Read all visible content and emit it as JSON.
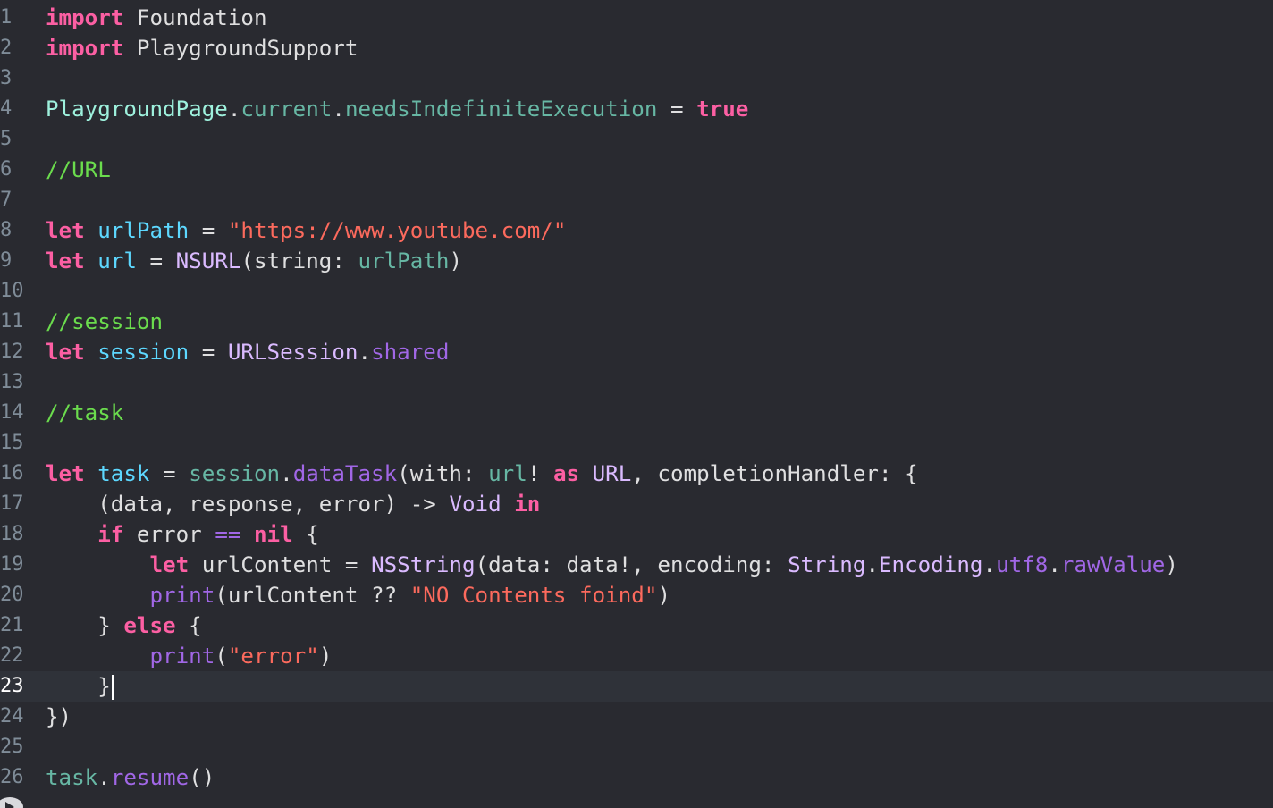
{
  "editor": {
    "language": "swift",
    "active_line": 23,
    "colors": {
      "background": "#292a30",
      "keyword": "#fc5fa3",
      "plain": "#dfdfe0",
      "type": "#dabaff",
      "project_symbol": "#67b7a4",
      "declaration": "#5dd8ff",
      "string": "#fc6a5d",
      "comment": "#6bdc4d",
      "method": "#a167e6"
    },
    "icons": {
      "run": "play-icon"
    },
    "line_numbers": [
      "1",
      "2",
      "3",
      "4",
      "5",
      "6",
      "7",
      "8",
      "9",
      "10",
      "11",
      "12",
      "13",
      "14",
      "15",
      "16",
      "17",
      "18",
      "19",
      "20",
      "21",
      "22",
      "23",
      "24",
      "25",
      "26"
    ],
    "lines": [
      [
        {
          "t": "kw",
          "v": "import"
        },
        {
          "t": "plain",
          "v": " Foundation"
        }
      ],
      [
        {
          "t": "kw",
          "v": "import"
        },
        {
          "t": "plain",
          "v": " PlaygroundSupport"
        }
      ],
      [],
      [
        {
          "t": "proj",
          "v": "PlaygroundPage"
        },
        {
          "t": "plain",
          "v": "."
        },
        {
          "t": "obj",
          "v": "current"
        },
        {
          "t": "plain",
          "v": "."
        },
        {
          "t": "obj",
          "v": "needsIndefiniteExecution"
        },
        {
          "t": "plain",
          "v": " = "
        },
        {
          "t": "kw",
          "v": "true"
        }
      ],
      [],
      [
        {
          "t": "com",
          "v": "//URL"
        }
      ],
      [],
      [
        {
          "t": "kw",
          "v": "let"
        },
        {
          "t": "plain",
          "v": " "
        },
        {
          "t": "var",
          "v": "urlPath"
        },
        {
          "t": "plain",
          "v": " = "
        },
        {
          "t": "str",
          "v": "\"https://www.youtube.com/\""
        }
      ],
      [
        {
          "t": "kw",
          "v": "let"
        },
        {
          "t": "plain",
          "v": " "
        },
        {
          "t": "var",
          "v": "url"
        },
        {
          "t": "plain",
          "v": " = "
        },
        {
          "t": "type",
          "v": "NSURL"
        },
        {
          "t": "plain",
          "v": "(string: "
        },
        {
          "t": "obj",
          "v": "urlPath"
        },
        {
          "t": "plain",
          "v": ")"
        }
      ],
      [],
      [
        {
          "t": "com",
          "v": "//session"
        }
      ],
      [
        {
          "t": "kw",
          "v": "let"
        },
        {
          "t": "plain",
          "v": " "
        },
        {
          "t": "var",
          "v": "session"
        },
        {
          "t": "plain",
          "v": " = "
        },
        {
          "t": "type",
          "v": "URLSession"
        },
        {
          "t": "plain",
          "v": "."
        },
        {
          "t": "meth",
          "v": "shared"
        }
      ],
      [],
      [
        {
          "t": "com",
          "v": "//task"
        }
      ],
      [],
      [
        {
          "t": "kw",
          "v": "let"
        },
        {
          "t": "plain",
          "v": " "
        },
        {
          "t": "var",
          "v": "task"
        },
        {
          "t": "plain",
          "v": " = "
        },
        {
          "t": "obj",
          "v": "session"
        },
        {
          "t": "plain",
          "v": "."
        },
        {
          "t": "meth",
          "v": "dataTask"
        },
        {
          "t": "plain",
          "v": "(with: "
        },
        {
          "t": "obj",
          "v": "url"
        },
        {
          "t": "plain",
          "v": "! "
        },
        {
          "t": "kw",
          "v": "as"
        },
        {
          "t": "plain",
          "v": " "
        },
        {
          "t": "type",
          "v": "URL"
        },
        {
          "t": "plain",
          "v": ", completionHandler: {"
        }
      ],
      [
        {
          "t": "plain",
          "v": "    (data, response, error) -> "
        },
        {
          "t": "type",
          "v": "Void"
        },
        {
          "t": "plain",
          "v": " "
        },
        {
          "t": "kw",
          "v": "in"
        }
      ],
      [
        {
          "t": "plain",
          "v": "    "
        },
        {
          "t": "kw",
          "v": "if"
        },
        {
          "t": "plain",
          "v": " error "
        },
        {
          "t": "meth",
          "v": "=="
        },
        {
          "t": "plain",
          "v": " "
        },
        {
          "t": "kw",
          "v": "nil"
        },
        {
          "t": "plain",
          "v": " {"
        }
      ],
      [
        {
          "t": "plain",
          "v": "        "
        },
        {
          "t": "kw",
          "v": "let"
        },
        {
          "t": "plain",
          "v": " urlContent = "
        },
        {
          "t": "type",
          "v": "NSString"
        },
        {
          "t": "plain",
          "v": "(data: data!, encoding: "
        },
        {
          "t": "type",
          "v": "String"
        },
        {
          "t": "plain",
          "v": "."
        },
        {
          "t": "type",
          "v": "Encoding"
        },
        {
          "t": "plain",
          "v": "."
        },
        {
          "t": "meth",
          "v": "utf8"
        },
        {
          "t": "plain",
          "v": "."
        },
        {
          "t": "meth",
          "v": "rawValue"
        },
        {
          "t": "plain",
          "v": ")"
        }
      ],
      [
        {
          "t": "plain",
          "v": "        "
        },
        {
          "t": "meth",
          "v": "print"
        },
        {
          "t": "plain",
          "v": "(urlContent ?? "
        },
        {
          "t": "str",
          "v": "\"NO Contents foind\""
        },
        {
          "t": "plain",
          "v": ")"
        }
      ],
      [
        {
          "t": "plain",
          "v": "    } "
        },
        {
          "t": "kw",
          "v": "else"
        },
        {
          "t": "plain",
          "v": " {"
        }
      ],
      [
        {
          "t": "plain",
          "v": "        "
        },
        {
          "t": "meth",
          "v": "print"
        },
        {
          "t": "plain",
          "v": "("
        },
        {
          "t": "str",
          "v": "\"error\""
        },
        {
          "t": "plain",
          "v": ")"
        }
      ],
      [
        {
          "t": "plain",
          "v": "    }"
        }
      ],
      [
        {
          "t": "plain",
          "v": "})"
        }
      ],
      [],
      [
        {
          "t": "obj",
          "v": "task"
        },
        {
          "t": "plain",
          "v": "."
        },
        {
          "t": "meth",
          "v": "resume"
        },
        {
          "t": "plain",
          "v": "()"
        }
      ]
    ]
  }
}
